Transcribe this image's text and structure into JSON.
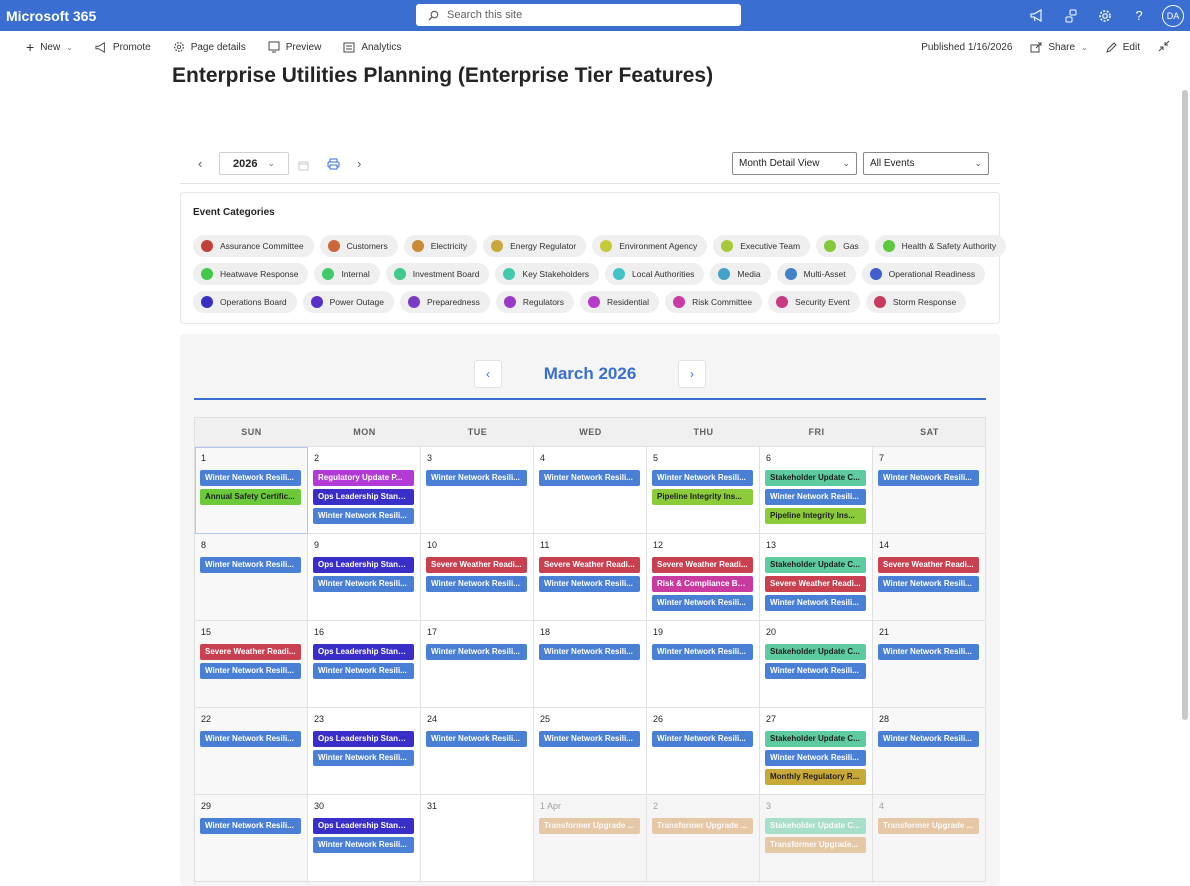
{
  "suite": {
    "brand": "Microsoft 365",
    "search_placeholder": "Search this site",
    "avatar": "DA"
  },
  "commands": {
    "new": "New",
    "promote": "Promote",
    "page_details": "Page details",
    "preview": "Preview",
    "analytics": "Analytics",
    "published": "Published 1/16/2026",
    "share": "Share",
    "edit": "Edit"
  },
  "page": {
    "title": "Enterprise Utilities Planning (Enterprise Tier Features)"
  },
  "toolbar": {
    "year": "2026",
    "view": "Month Detail View",
    "filter": "All Events"
  },
  "categories": {
    "title": "Event Categories",
    "rows": [
      [
        {
          "label": "Assurance Committee",
          "color": "#c0413a"
        },
        {
          "label": "Customers",
          "color": "#c9663a"
        },
        {
          "label": "Electricity",
          "color": "#c98a3a"
        },
        {
          "label": "Energy Regulator",
          "color": "#c9a83a"
        },
        {
          "label": "Environment Agency",
          "color": "#c6c93a"
        },
        {
          "label": "Executive Team",
          "color": "#a6c93a"
        },
        {
          "label": "Gas",
          "color": "#86c93a"
        },
        {
          "label": "Health & Safety Authority",
          "color": "#5ec93a"
        }
      ],
      [
        {
          "label": "Heatwave Response",
          "color": "#42c94a"
        },
        {
          "label": "Internal",
          "color": "#42c96a"
        },
        {
          "label": "Investment Board",
          "color": "#42c98e"
        },
        {
          "label": "Key Stakeholders",
          "color": "#42c9ae"
        },
        {
          "label": "Local Authorities",
          "color": "#42c2c9"
        },
        {
          "label": "Media",
          "color": "#42a2c9"
        },
        {
          "label": "Multi-Asset",
          "color": "#4282c9"
        },
        {
          "label": "Operational Readiness",
          "color": "#425ec9"
        }
      ],
      [
        {
          "label": "Operations Board",
          "color": "#3a2ec0"
        },
        {
          "label": "Power Outage",
          "color": "#5a2ec9"
        },
        {
          "label": "Preparedness",
          "color": "#7a3ac9"
        },
        {
          "label": "Regulators",
          "color": "#9a3ac9"
        },
        {
          "label": "Residential",
          "color": "#b63ac9"
        },
        {
          "label": "Risk Committee",
          "color": "#c93aa6"
        },
        {
          "label": "Security Event",
          "color": "#c93a82"
        },
        {
          "label": "Storm Response",
          "color": "#c93a5e"
        }
      ]
    ]
  },
  "calendar": {
    "month_title": "March 2026",
    "prev": "‹",
    "next": "›",
    "weekdays": [
      "SUN",
      "MON",
      "TUE",
      "WED",
      "THU",
      "FRI",
      "SAT"
    ],
    "colors": {
      "winter": "#4a7fd6",
      "safety": "#6bc93a",
      "regulatory": "#b23ad6",
      "ops": "#3a2ec9",
      "stakeholder": "#5ecaa0",
      "pipeline": "#8ccc3a",
      "severe": "#c94050",
      "risk": "#c93aa0",
      "monthly": "#c9a83a",
      "transformer": "#d99a5a"
    },
    "weeks": [
      [
        {
          "day": "1",
          "weekend": true,
          "today": true,
          "events": [
            {
              "t": "Winter Network Resili...",
              "c": "winter"
            },
            {
              "t": "Annual Safety Certific...",
              "c": "safety",
              "dark": true
            }
          ]
        },
        {
          "day": "2",
          "events": [
            {
              "t": "Regulatory Update P...",
              "c": "regulatory"
            },
            {
              "t": "Ops Leadership Stand...",
              "c": "ops"
            },
            {
              "t": "Winter Network Resili...",
              "c": "winter"
            }
          ]
        },
        {
          "day": "3",
          "events": [
            {
              "t": "Winter Network Resili...",
              "c": "winter"
            }
          ]
        },
        {
          "day": "4",
          "events": [
            {
              "t": "Winter Network Resili...",
              "c": "winter"
            }
          ]
        },
        {
          "day": "5",
          "events": [
            {
              "t": "Winter Network Resili...",
              "c": "winter"
            },
            {
              "t": "Pipeline Integrity Ins...",
              "c": "pipeline",
              "dark": true
            }
          ]
        },
        {
          "day": "6",
          "events": [
            {
              "t": "Stakeholder Update C...",
              "c": "stakeholder",
              "dark": true
            },
            {
              "t": "Winter Network Resili...",
              "c": "winter"
            },
            {
              "t": "Pipeline Integrity Ins...",
              "c": "pipeline",
              "dark": true
            }
          ]
        },
        {
          "day": "7",
          "weekend": true,
          "events": [
            {
              "t": "Winter Network Resili...",
              "c": "winter"
            }
          ]
        }
      ],
      [
        {
          "day": "8",
          "weekend": true,
          "events": [
            {
              "t": "Winter Network Resili...",
              "c": "winter"
            }
          ]
        },
        {
          "day": "9",
          "events": [
            {
              "t": "Ops Leadership Stand...",
              "c": "ops"
            },
            {
              "t": "Winter Network Resili...",
              "c": "winter"
            }
          ]
        },
        {
          "day": "10",
          "events": [
            {
              "t": "Severe Weather Readi...",
              "c": "severe"
            },
            {
              "t": "Winter Network Resili...",
              "c": "winter"
            }
          ]
        },
        {
          "day": "11",
          "events": [
            {
              "t": "Severe Weather Readi...",
              "c": "severe"
            },
            {
              "t": "Winter Network Resili...",
              "c": "winter"
            }
          ]
        },
        {
          "day": "12",
          "events": [
            {
              "t": "Severe Weather Readi...",
              "c": "severe"
            },
            {
              "t": "Risk & Compliance Bo...",
              "c": "risk"
            },
            {
              "t": "Winter Network Resili...",
              "c": "winter"
            }
          ]
        },
        {
          "day": "13",
          "events": [
            {
              "t": "Stakeholder Update C...",
              "c": "stakeholder",
              "dark": true
            },
            {
              "t": "Severe Weather Readi...",
              "c": "severe"
            },
            {
              "t": "Winter Network Resili...",
              "c": "winter"
            }
          ]
        },
        {
          "day": "14",
          "weekend": true,
          "events": [
            {
              "t": "Severe Weather Readi...",
              "c": "severe"
            },
            {
              "t": "Winter Network Resili...",
              "c": "winter"
            }
          ]
        }
      ],
      [
        {
          "day": "15",
          "weekend": true,
          "events": [
            {
              "t": "Severe Weather Readi...",
              "c": "severe"
            },
            {
              "t": "Winter Network Resili...",
              "c": "winter"
            }
          ]
        },
        {
          "day": "16",
          "events": [
            {
              "t": "Ops Leadership Stand...",
              "c": "ops"
            },
            {
              "t": "Winter Network Resili...",
              "c": "winter"
            }
          ]
        },
        {
          "day": "17",
          "events": [
            {
              "t": "Winter Network Resili...",
              "c": "winter"
            }
          ]
        },
        {
          "day": "18",
          "events": [
            {
              "t": "Winter Network Resili...",
              "c": "winter"
            }
          ]
        },
        {
          "day": "19",
          "events": [
            {
              "t": "Winter Network Resili...",
              "c": "winter"
            }
          ]
        },
        {
          "day": "20",
          "events": [
            {
              "t": "Stakeholder Update C...",
              "c": "stakeholder",
              "dark": true
            },
            {
              "t": "Winter Network Resili...",
              "c": "winter"
            }
          ]
        },
        {
          "day": "21",
          "weekend": true,
          "events": [
            {
              "t": "Winter Network Resili...",
              "c": "winter"
            }
          ]
        }
      ],
      [
        {
          "day": "22",
          "weekend": true,
          "events": [
            {
              "t": "Winter Network Resili...",
              "c": "winter"
            }
          ]
        },
        {
          "day": "23",
          "events": [
            {
              "t": "Ops Leadership Stand...",
              "c": "ops"
            },
            {
              "t": "Winter Network Resili...",
              "c": "winter"
            }
          ]
        },
        {
          "day": "24",
          "events": [
            {
              "t": "Winter Network Resili...",
              "c": "winter"
            }
          ]
        },
        {
          "day": "25",
          "events": [
            {
              "t": "Winter Network Resili...",
              "c": "winter"
            }
          ]
        },
        {
          "day": "26",
          "events": [
            {
              "t": "Winter Network Resili...",
              "c": "winter"
            }
          ]
        },
        {
          "day": "27",
          "events": [
            {
              "t": "Stakeholder Update C...",
              "c": "stakeholder",
              "dark": true
            },
            {
              "t": "Winter Network Resili...",
              "c": "winter"
            },
            {
              "t": "Monthly Regulatory R...",
              "c": "monthly",
              "dark": true
            }
          ]
        },
        {
          "day": "28",
          "weekend": true,
          "events": [
            {
              "t": "Winter Network Resili...",
              "c": "winter"
            }
          ]
        }
      ],
      [
        {
          "day": "29",
          "weekend": true,
          "events": [
            {
              "t": "Winter Network Resili...",
              "c": "winter"
            }
          ]
        },
        {
          "day": "30",
          "events": [
            {
              "t": "Ops Leadership Stand...",
              "c": "ops"
            },
            {
              "t": "Winter Network Resili...",
              "c": "winter"
            }
          ]
        },
        {
          "day": "31",
          "events": []
        },
        {
          "day": "1 Apr",
          "other": true,
          "events": [
            {
              "t": "Transformer Upgrade ...",
              "c": "transformer",
              "faded": true
            }
          ]
        },
        {
          "day": "2",
          "other": true,
          "events": [
            {
              "t": "Transformer Upgrade ...",
              "c": "transformer",
              "faded": true
            }
          ]
        },
        {
          "day": "3",
          "other": true,
          "events": [
            {
              "t": "Stakeholder Update C...",
              "c": "stakeholder",
              "faded": true
            },
            {
              "t": "Transformer Upgrade...",
              "c": "transformer",
              "faded": true
            }
          ]
        },
        {
          "day": "4",
          "other": true,
          "events": [
            {
              "t": "Transformer Upgrade ...",
              "c": "transformer",
              "faded": true
            }
          ]
        }
      ]
    ]
  }
}
